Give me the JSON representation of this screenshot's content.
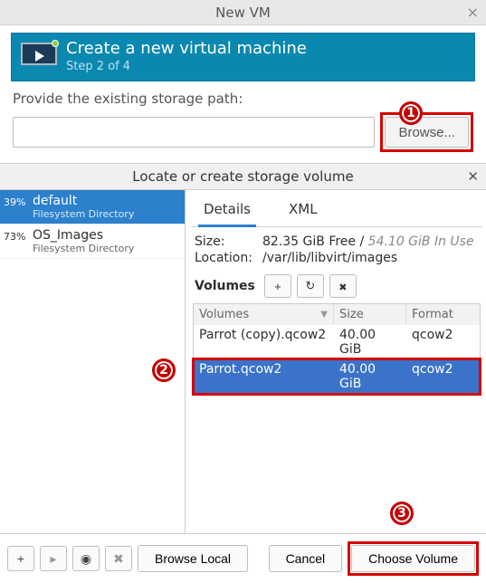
{
  "newvm": {
    "title": "New VM",
    "banner_title": "Create a new virtual machine",
    "banner_step": "Step 2 of 4",
    "path_label": "Provide the existing storage path:",
    "path_value": "",
    "browse_label": "Browse..."
  },
  "locate": {
    "title": "Locate or create storage volume"
  },
  "pools": [
    {
      "percent": "39%",
      "name": "default",
      "type": "Filesystem Directory",
      "selected": true
    },
    {
      "percent": "73%",
      "name": "OS_Images",
      "type": "Filesystem Directory",
      "selected": false
    }
  ],
  "tabs": {
    "details": "Details",
    "xml": "XML",
    "active": "details"
  },
  "details": {
    "size_label": "Size:",
    "size_free": "82.35 GiB Free /",
    "size_used": "54.10 GiB In Use",
    "location_label": "Location:",
    "location_value": "/var/lib/libvirt/images"
  },
  "volumes": {
    "label": "Volumes",
    "columns": {
      "name": "Volumes",
      "size": "Size",
      "format": "Format"
    },
    "rows": [
      {
        "name": "Parrot (copy).qcow2",
        "size": "40.00 GiB",
        "format": "qcow2",
        "selected": false
      },
      {
        "name": "Parrot.qcow2",
        "size": "40.00 GiB",
        "format": "qcow2",
        "selected": true
      }
    ]
  },
  "bottom": {
    "browse_local": "Browse Local",
    "cancel": "Cancel",
    "choose": "Choose Volume"
  },
  "annotations": {
    "b1": "1",
    "b2": "2",
    "b3": "3"
  }
}
